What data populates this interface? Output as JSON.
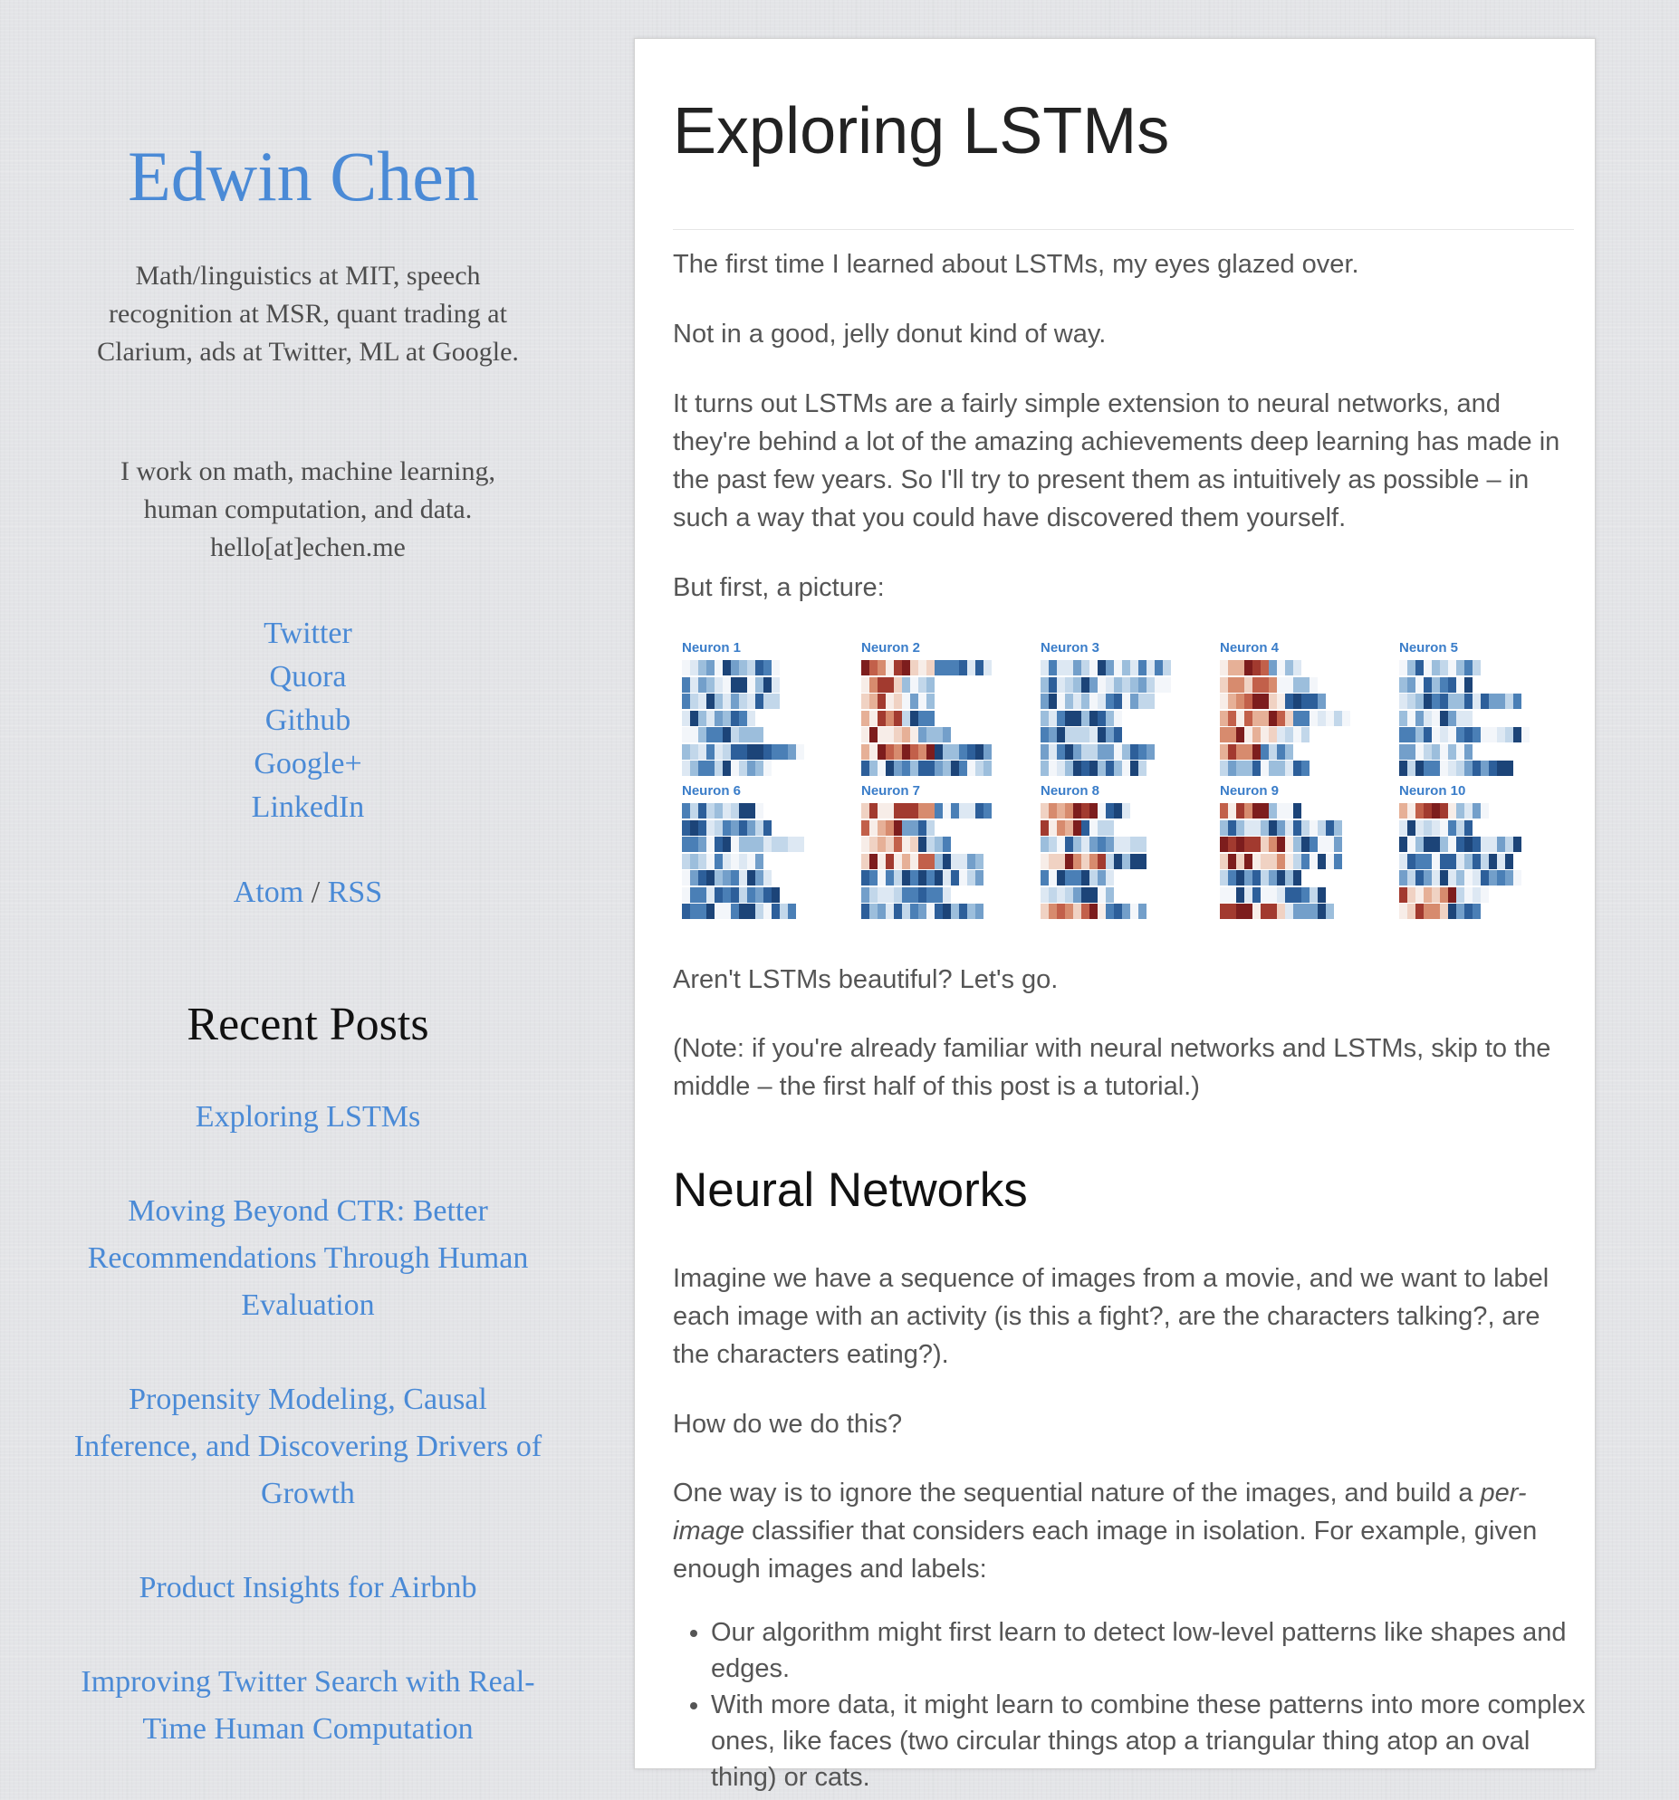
{
  "sidebar": {
    "site_title": "Edwin Chen",
    "bio_line1": "Math/linguistics at MIT, speech recognition at MSR, quant trading at Clarium, ads at Twitter, ML at Google.",
    "bio_line2": "I work on math, machine learning, human computation, and data. hello[at]echen.me",
    "social_links": [
      "Twitter",
      "Quora",
      "Github",
      "Google+",
      "LinkedIn"
    ],
    "feed_atom": "Atom",
    "feed_separator": "/",
    "feed_rss": "RSS",
    "recent_posts_title": "Recent Posts",
    "recent_posts": [
      "Exploring LSTMs",
      "Moving Beyond CTR: Better Recommendations Through Human Evaluation",
      "Propensity Modeling, Causal Inference, and Discovering Drivers of Growth",
      "Product Insights for Airbnb",
      "Improving Twitter Search with Real-Time Human Computation"
    ]
  },
  "post": {
    "title": "Exploring LSTMs",
    "p1": "The first time I learned about LSTMs, my eyes glazed over.",
    "p2": "Not in a good, jelly donut kind of way.",
    "p3": "It turns out LSTMs are a fairly simple extension to neural networks, and they're behind a lot of the amazing achievements deep learning has made in the past few years. So I'll try to present them as intuitively as possible – in such a way that you could have discovered them yourself.",
    "p4": "But first, a picture:",
    "figure_panels": [
      "Neuron 1",
      "Neuron 2",
      "Neuron 3",
      "Neuron 4",
      "Neuron 5",
      "Neuron 6",
      "Neuron 7",
      "Neuron 8",
      "Neuron 9",
      "Neuron 10"
    ],
    "p5": "Aren't LSTMs beautiful? Let's go.",
    "p6": "(Note: if you're already familiar with neural networks and LSTMs, skip to the middle – the first half of this post is a tutorial.)",
    "section_title": "Neural Networks",
    "p7": "Imagine we have a sequence of images from a movie, and we want to label each image with an activity (is this a fight?, are the characters talking?, are the characters eating?).",
    "p8": "How do we do this?",
    "p9_before": "One way is to ignore the sequential nature of the images, and build a ",
    "p9_em": "per-image",
    "p9_after": " classifier that considers each image in isolation. For example, given enough images and labels:",
    "bullets": [
      "Our algorithm might first learn to detect low-level patterns like shapes and edges.",
      "With more data, it might learn to combine these patterns into more complex ones, like faces (two circular things atop a triangular thing atop an oval thing) or cats."
    ]
  },
  "colors": {
    "link": "#4a8ad6",
    "text": "#555555",
    "heading": "#111111",
    "neuron_label": "#3a7dc9",
    "heat_blue_dark": "#1f4e8a",
    "heat_red_dark": "#7d1d1d"
  }
}
